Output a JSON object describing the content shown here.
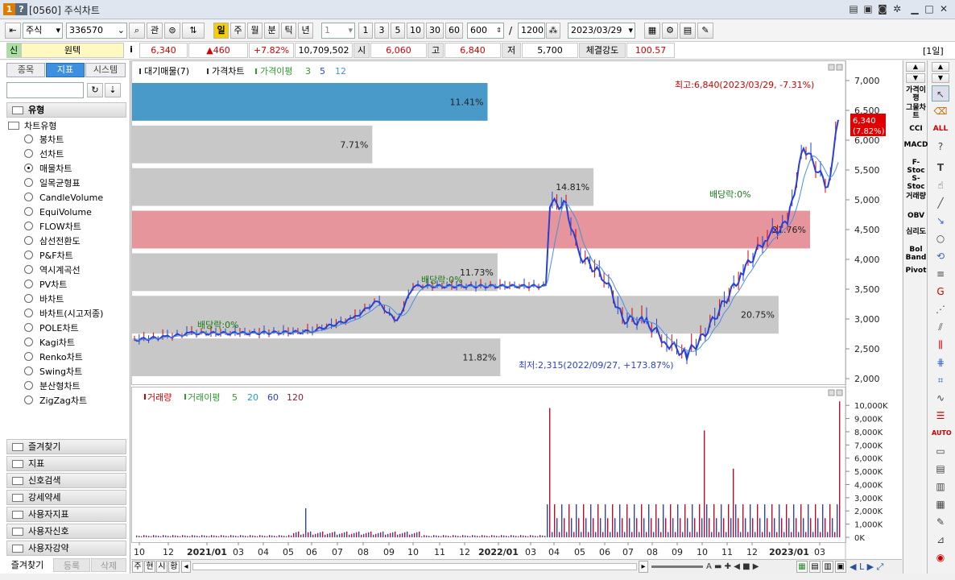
{
  "titlebar": {
    "badge1": "1",
    "badge2": "?",
    "title": "[0560] 주식차트"
  },
  "toolbar": {
    "market": "주식",
    "code": "336570",
    "watch": "관",
    "periods": [
      "일",
      "주",
      "월",
      "분",
      "틱",
      "년"
    ],
    "multiplier": "1",
    "quick_counts": [
      "1",
      "3",
      "5",
      "10",
      "30",
      "60"
    ],
    "view_count": "600",
    "slash": "/",
    "total_count": "1200",
    "date": "2023/03/29"
  },
  "inforow": {
    "badge": "신",
    "name": "원텍",
    "info_icon": "i",
    "price": "6,340",
    "change": "▲460",
    "change_pct": "+7.82%",
    "volume": "10,709,502",
    "open_label": "시",
    "open": "6,060",
    "high_label": "고",
    "high": "6,840",
    "low_label": "저",
    "low": "5,700",
    "strength_label": "체결강도",
    "strength": "100.57",
    "period_badge": "[1일]"
  },
  "leftpanel": {
    "tabs": [
      "종목",
      "지표",
      "시스템"
    ],
    "group_title": "유형",
    "tree_root": "차트유형",
    "chart_types": [
      "봉차트",
      "선차트",
      "매물차트",
      "일목균형표",
      "CandleVolume",
      "EquiVolume",
      "FLOW차트",
      "삼선전환도",
      "P&F차트",
      "역시계곡선",
      "PV차트",
      "바차트",
      "바차트(시고저종)",
      "POLE차트",
      "Kagi차트",
      "Renko차트",
      "Swing차트",
      "분산형차트",
      "ZigZag차트"
    ],
    "selected": "매물차트",
    "sections": [
      "즐겨찾기",
      "지표",
      "신호검색",
      "강세약세",
      "사용자지표",
      "사용자신호",
      "사용자강약"
    ],
    "bottom_tabs": [
      "즐겨찾기",
      "등록",
      "삭제"
    ]
  },
  "chart": {
    "price_legend": [
      "대기매물(7)",
      "가격차트",
      "가격이평",
      "3",
      "5",
      "12"
    ],
    "volume_legend": [
      "거래량",
      "거래이평",
      "5",
      "20",
      "60",
      "120"
    ],
    "high_note": "최고:6,840(2023/03/29, -7.31%)",
    "low_note": "최저:2,315(2022/09/27, +173.87%)",
    "dividend_notes": [
      "배당락:0%",
      "배당락:0%",
      "배당락:0%"
    ],
    "current_price": "6,340",
    "current_pct": "(7.82%)"
  },
  "chart_data": [
    {
      "type": "bar",
      "title": "대기매물(7)",
      "categories": [
        "2,000-2,715",
        "2,715-3,430",
        "3,430-4,145",
        "4,145-4,860",
        "4,860-5,575",
        "5,575-6,290",
        "6,290-7,000"
      ],
      "values": [
        11.82,
        20.75,
        11.73,
        21.76,
        14.81,
        7.71,
        11.41
      ],
      "labels": [
        "11.82%",
        "20.75%",
        "11.73%",
        "21.76%",
        "14.81%",
        "7.71%",
        "11.41%"
      ],
      "colors": [
        "#c8c8c8",
        "#c8c8c8",
        "#c8c8c8",
        "#e5959b",
        "#c8c8c8",
        "#c8c8c8",
        "#4a9ac9"
      ]
    },
    {
      "type": "line",
      "title": "가격차트",
      "x": [
        "2020/10",
        "2020/12",
        "2021/01",
        "2021/03",
        "2021/05",
        "2021/06",
        "2021/08",
        "2021/09",
        "2021/10",
        "2021/11",
        "2022/03",
        "2022/04",
        "2022/04",
        "2022/05",
        "2022/06",
        "2022/07",
        "2022/08",
        "2022/09",
        "2022/09",
        "2022/10",
        "2022/11",
        "2022/12",
        "2023/01",
        "2023/02",
        "2023/03",
        "2023/03"
      ],
      "y": [
        2650,
        2700,
        2760,
        2760,
        2780,
        2800,
        3000,
        3300,
        2950,
        3550,
        3550,
        4950,
        4900,
        4100,
        3650,
        3000,
        2950,
        2600,
        2400,
        2700,
        3800,
        4400,
        4600,
        5900,
        5200,
        6340
      ],
      "ylim": [
        2000,
        7000
      ],
      "yticks": [
        "7,000",
        "6,500",
        "6,000",
        "5,500",
        "5,000",
        "4,500",
        "4,000",
        "3,500",
        "3,000",
        "2,500",
        "2,000"
      ]
    },
    {
      "type": "bar",
      "title": "거래량",
      "ylim": [
        0,
        10500000
      ],
      "yticks": [
        "10,000K",
        "9,000K",
        "8,000K",
        "7,000K",
        "6,000K",
        "5,000K",
        "4,000K",
        "3,000K",
        "2,000K",
        "1,000K",
        "0K"
      ]
    }
  ],
  "xaxis": [
    "10",
    "12",
    "2021/01",
    "03",
    "04",
    "05",
    "06",
    "07",
    "08",
    "09",
    "10",
    "11",
    "12",
    "2022/01",
    "03",
    "04",
    "05",
    "06",
    "07",
    "08",
    "09",
    "10",
    "11",
    "12",
    "2023/01",
    "03"
  ],
  "right_indicators": [
    "가격이평",
    "그물차트",
    "CCI",
    "MACD",
    "F-Stoc",
    "S-Stoc",
    "거래량",
    "OBV",
    "심리도",
    "Bol Band",
    "Pivot"
  ],
  "bottom": {
    "mode_buttons": [
      "주",
      "현",
      "시",
      "황"
    ]
  }
}
